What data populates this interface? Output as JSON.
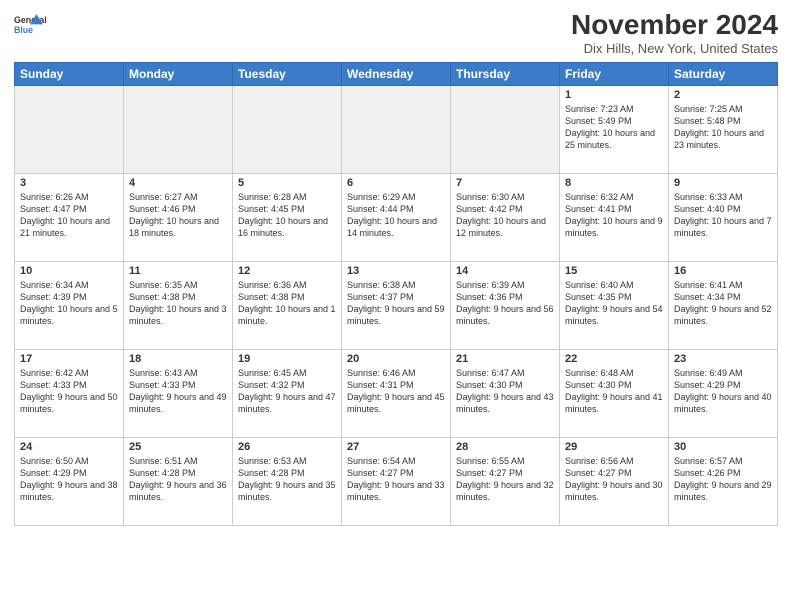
{
  "header": {
    "logo_line1": "General",
    "logo_line2": "Blue",
    "month_title": "November 2024",
    "location": "Dix Hills, New York, United States"
  },
  "calendar": {
    "headers": [
      "Sunday",
      "Monday",
      "Tuesday",
      "Wednesday",
      "Thursday",
      "Friday",
      "Saturday"
    ],
    "weeks": [
      [
        {
          "day": "",
          "info": ""
        },
        {
          "day": "",
          "info": ""
        },
        {
          "day": "",
          "info": ""
        },
        {
          "day": "",
          "info": ""
        },
        {
          "day": "",
          "info": ""
        },
        {
          "day": "1",
          "info": "Sunrise: 7:23 AM\nSunset: 5:49 PM\nDaylight: 10 hours and 25 minutes."
        },
        {
          "day": "2",
          "info": "Sunrise: 7:25 AM\nSunset: 5:48 PM\nDaylight: 10 hours and 23 minutes."
        }
      ],
      [
        {
          "day": "3",
          "info": "Sunrise: 6:26 AM\nSunset: 4:47 PM\nDaylight: 10 hours and 21 minutes."
        },
        {
          "day": "4",
          "info": "Sunrise: 6:27 AM\nSunset: 4:46 PM\nDaylight: 10 hours and 18 minutes."
        },
        {
          "day": "5",
          "info": "Sunrise: 6:28 AM\nSunset: 4:45 PM\nDaylight: 10 hours and 16 minutes."
        },
        {
          "day": "6",
          "info": "Sunrise: 6:29 AM\nSunset: 4:44 PM\nDaylight: 10 hours and 14 minutes."
        },
        {
          "day": "7",
          "info": "Sunrise: 6:30 AM\nSunset: 4:42 PM\nDaylight: 10 hours and 12 minutes."
        },
        {
          "day": "8",
          "info": "Sunrise: 6:32 AM\nSunset: 4:41 PM\nDaylight: 10 hours and 9 minutes."
        },
        {
          "day": "9",
          "info": "Sunrise: 6:33 AM\nSunset: 4:40 PM\nDaylight: 10 hours and 7 minutes."
        }
      ],
      [
        {
          "day": "10",
          "info": "Sunrise: 6:34 AM\nSunset: 4:39 PM\nDaylight: 10 hours and 5 minutes."
        },
        {
          "day": "11",
          "info": "Sunrise: 6:35 AM\nSunset: 4:38 PM\nDaylight: 10 hours and 3 minutes."
        },
        {
          "day": "12",
          "info": "Sunrise: 6:36 AM\nSunset: 4:38 PM\nDaylight: 10 hours and 1 minute."
        },
        {
          "day": "13",
          "info": "Sunrise: 6:38 AM\nSunset: 4:37 PM\nDaylight: 9 hours and 59 minutes."
        },
        {
          "day": "14",
          "info": "Sunrise: 6:39 AM\nSunset: 4:36 PM\nDaylight: 9 hours and 56 minutes."
        },
        {
          "day": "15",
          "info": "Sunrise: 6:40 AM\nSunset: 4:35 PM\nDaylight: 9 hours and 54 minutes."
        },
        {
          "day": "16",
          "info": "Sunrise: 6:41 AM\nSunset: 4:34 PM\nDaylight: 9 hours and 52 minutes."
        }
      ],
      [
        {
          "day": "17",
          "info": "Sunrise: 6:42 AM\nSunset: 4:33 PM\nDaylight: 9 hours and 50 minutes."
        },
        {
          "day": "18",
          "info": "Sunrise: 6:43 AM\nSunset: 4:33 PM\nDaylight: 9 hours and 49 minutes."
        },
        {
          "day": "19",
          "info": "Sunrise: 6:45 AM\nSunset: 4:32 PM\nDaylight: 9 hours and 47 minutes."
        },
        {
          "day": "20",
          "info": "Sunrise: 6:46 AM\nSunset: 4:31 PM\nDaylight: 9 hours and 45 minutes."
        },
        {
          "day": "21",
          "info": "Sunrise: 6:47 AM\nSunset: 4:30 PM\nDaylight: 9 hours and 43 minutes."
        },
        {
          "day": "22",
          "info": "Sunrise: 6:48 AM\nSunset: 4:30 PM\nDaylight: 9 hours and 41 minutes."
        },
        {
          "day": "23",
          "info": "Sunrise: 6:49 AM\nSunset: 4:29 PM\nDaylight: 9 hours and 40 minutes."
        }
      ],
      [
        {
          "day": "24",
          "info": "Sunrise: 6:50 AM\nSunset: 4:29 PM\nDaylight: 9 hours and 38 minutes."
        },
        {
          "day": "25",
          "info": "Sunrise: 6:51 AM\nSunset: 4:28 PM\nDaylight: 9 hours and 36 minutes."
        },
        {
          "day": "26",
          "info": "Sunrise: 6:53 AM\nSunset: 4:28 PM\nDaylight: 9 hours and 35 minutes."
        },
        {
          "day": "27",
          "info": "Sunrise: 6:54 AM\nSunset: 4:27 PM\nDaylight: 9 hours and 33 minutes."
        },
        {
          "day": "28",
          "info": "Sunrise: 6:55 AM\nSunset: 4:27 PM\nDaylight: 9 hours and 32 minutes."
        },
        {
          "day": "29",
          "info": "Sunrise: 6:56 AM\nSunset: 4:27 PM\nDaylight: 9 hours and 30 minutes."
        },
        {
          "day": "30",
          "info": "Sunrise: 6:57 AM\nSunset: 4:26 PM\nDaylight: 9 hours and 29 minutes."
        }
      ]
    ]
  }
}
